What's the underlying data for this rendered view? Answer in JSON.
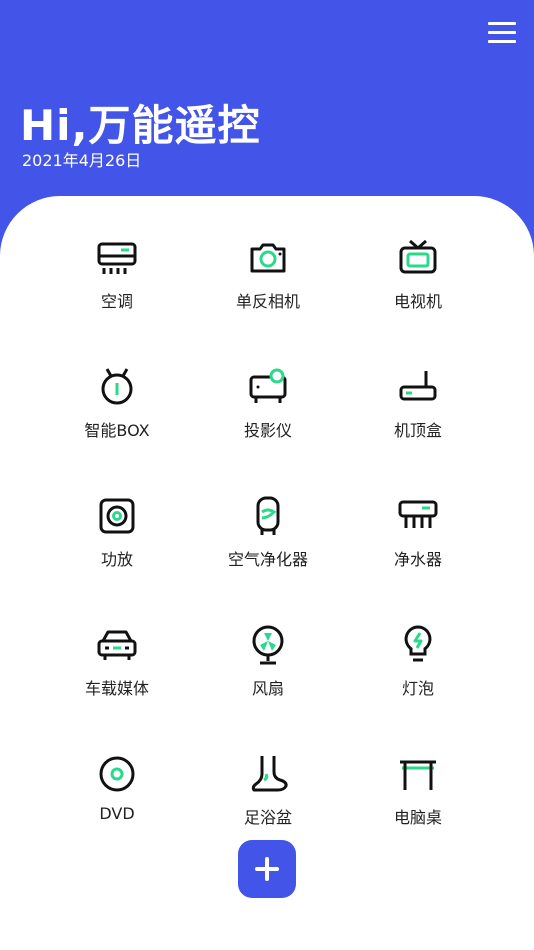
{
  "header": {
    "title": "Hi,万能遥控",
    "date": "2021年4月26日"
  },
  "colors": {
    "accent": "#4255e8",
    "icon_green": "#2bd98a",
    "icon_stroke": "#111111"
  },
  "devices": [
    {
      "label": "空调",
      "icon": "air-conditioner-icon"
    },
    {
      "label": "单反相机",
      "icon": "camera-icon"
    },
    {
      "label": "电视机",
      "icon": "tv-icon"
    },
    {
      "label": "智能BOX",
      "icon": "smart-box-icon"
    },
    {
      "label": "投影仪",
      "icon": "projector-icon"
    },
    {
      "label": "机顶盒",
      "icon": "set-top-box-icon"
    },
    {
      "label": "功放",
      "icon": "speaker-icon"
    },
    {
      "label": "空气净化器",
      "icon": "air-purifier-icon"
    },
    {
      "label": "净水器",
      "icon": "water-purifier-icon"
    },
    {
      "label": "车载媒体",
      "icon": "car-icon"
    },
    {
      "label": "风扇",
      "icon": "fan-icon"
    },
    {
      "label": "灯泡",
      "icon": "light-bulb-icon"
    },
    {
      "label": "DVD",
      "icon": "dvd-icon"
    },
    {
      "label": "足浴盆",
      "icon": "foot-bath-icon"
    },
    {
      "label": "电脑桌",
      "icon": "computer-desk-icon"
    }
  ]
}
